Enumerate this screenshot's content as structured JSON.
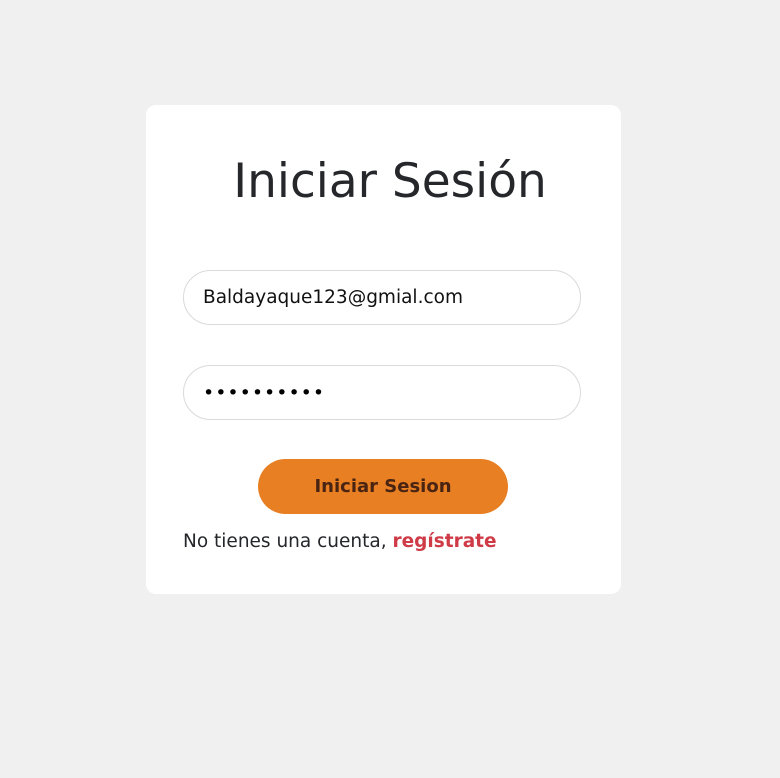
{
  "login": {
    "title": "Iniciar Sesión",
    "email_value": "Baldayaque123@gmial.com",
    "password_value": "••••••••••",
    "submit_label": "Iniciar Sesion",
    "footer_text": "No tienes una cuenta, ",
    "register_link_label": "regístrate"
  },
  "colors": {
    "background": "#f0f0f0",
    "card": "#ffffff",
    "button": "#e87f23",
    "button_text": "#4a2412",
    "link": "#cf3a47",
    "text": "#25272b"
  }
}
